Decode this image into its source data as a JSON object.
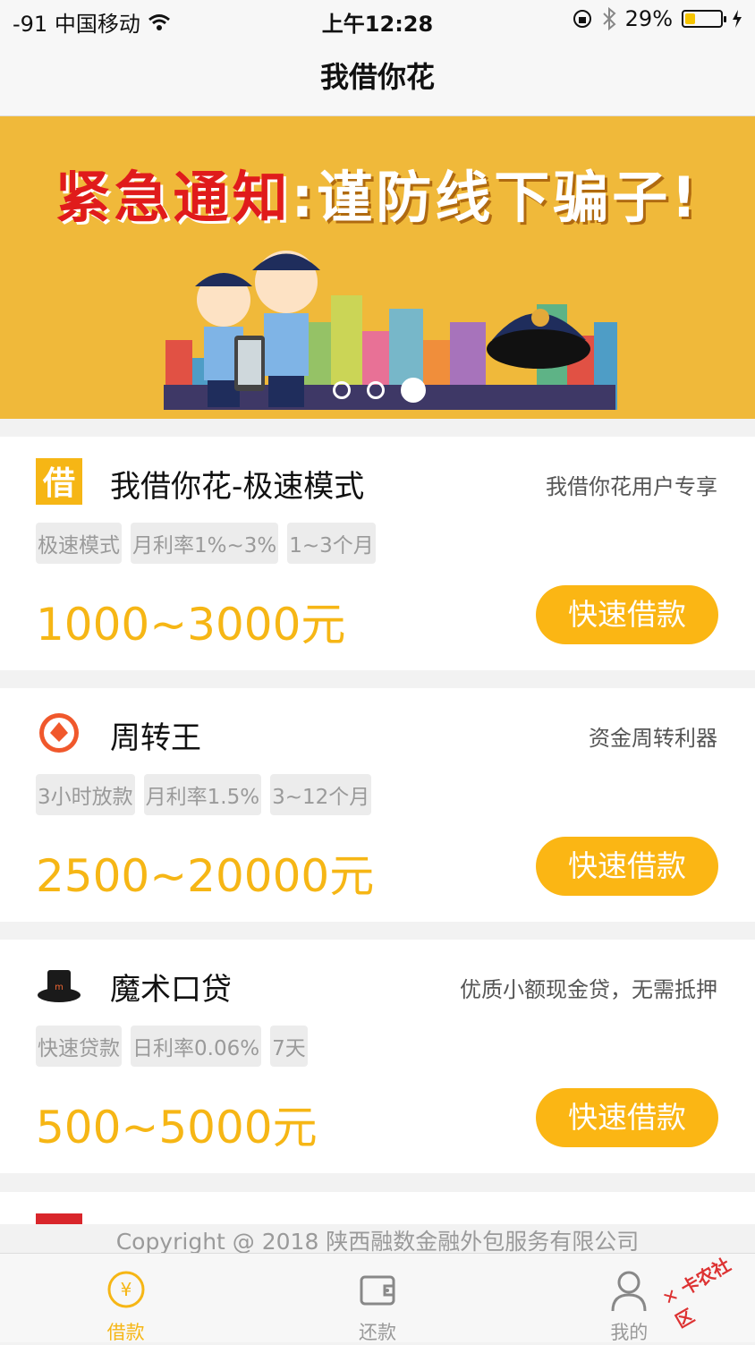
{
  "statusbar": {
    "carrier": "-91 中国移动",
    "time": "上午12:28",
    "battery_text": "29%",
    "battery_level": 0.29
  },
  "navbar": {
    "title": "我借你花"
  },
  "banner": {
    "headline_red": "紧急通知",
    "headline_sep": ":",
    "headline_white": "谨防线下骗子!",
    "page_count": 3,
    "active_page": 2
  },
  "products": [
    {
      "name": "我借你花-极速模式",
      "tagline": "我借你花用户专享",
      "tags": [
        "极速模式",
        "月利率1%~3%",
        "1~3个月"
      ],
      "amount": "1000~3000元",
      "button": "快速借款",
      "logo": "jie-char-icon"
    },
    {
      "name": "周转王",
      "tagline": "资金周转利器",
      "tags": [
        "3小时放款",
        "月利率1.5%",
        "3~12个月"
      ],
      "amount": "2500~20000元",
      "button": "快速借款",
      "logo": "orange-diamond-icon"
    },
    {
      "name": "魔术口贷",
      "tagline": "优质小额现金贷，无需抵押",
      "tags": [
        "快速贷款",
        "日利率0.06%",
        "7天"
      ],
      "amount": "500~5000元",
      "button": "快速借款",
      "logo": "magic-hat-icon"
    }
  ],
  "copyright": "Copyright @ 2018 陕西融数金融外包服务有限公司",
  "tabbar": {
    "items": [
      {
        "label": "借款",
        "icon": "yuan-circle-icon",
        "active": true
      },
      {
        "label": "还款",
        "icon": "wallet-icon",
        "active": false
      },
      {
        "label": "我的",
        "icon": "person-icon",
        "active": false
      }
    ]
  },
  "watermark": "卡农社区",
  "colors": {
    "accent": "#f6b615",
    "button": "#fbb614",
    "banner_bg": "#f0b93a"
  }
}
